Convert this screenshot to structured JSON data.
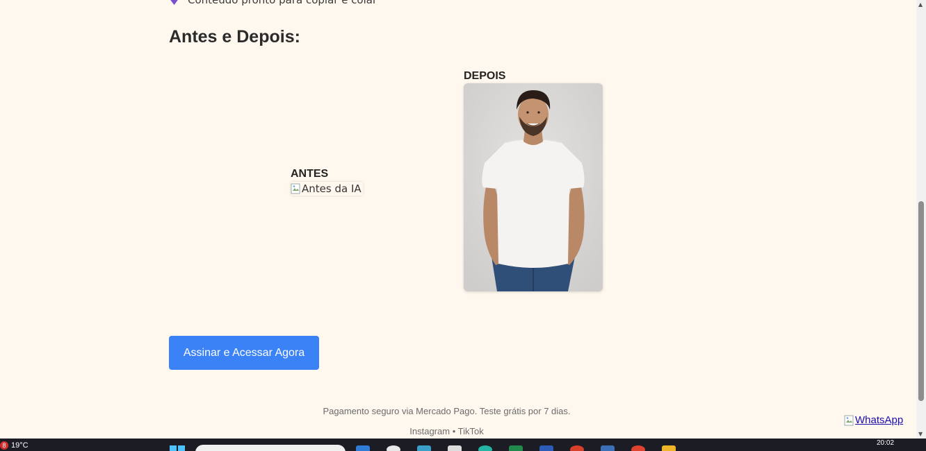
{
  "page": {
    "top_bullet_text": "Conteúdo pronto para copiar e colar",
    "section_title": "Antes e Depois:"
  },
  "comparison": {
    "before_label": "ANTES",
    "before_image_alt": "Antes da IA",
    "after_label": "DEPOIS"
  },
  "cta": {
    "label": "Assinar e Acessar Agora"
  },
  "footer": {
    "note": "Pagamento seguro via Mercado Pago. Teste grátis por 7 dias.",
    "instagram": "Instagram",
    "separator": "•",
    "tiktok": "TikTok"
  },
  "whatsapp": {
    "alt": "WhatsApp"
  },
  "taskbar": {
    "weather_badge": "8",
    "temperature": "19°C",
    "clock": "20:02"
  },
  "colors": {
    "background": "#fff8ef",
    "cta": "#3b82f6",
    "bullet": "#7c4dcc"
  }
}
